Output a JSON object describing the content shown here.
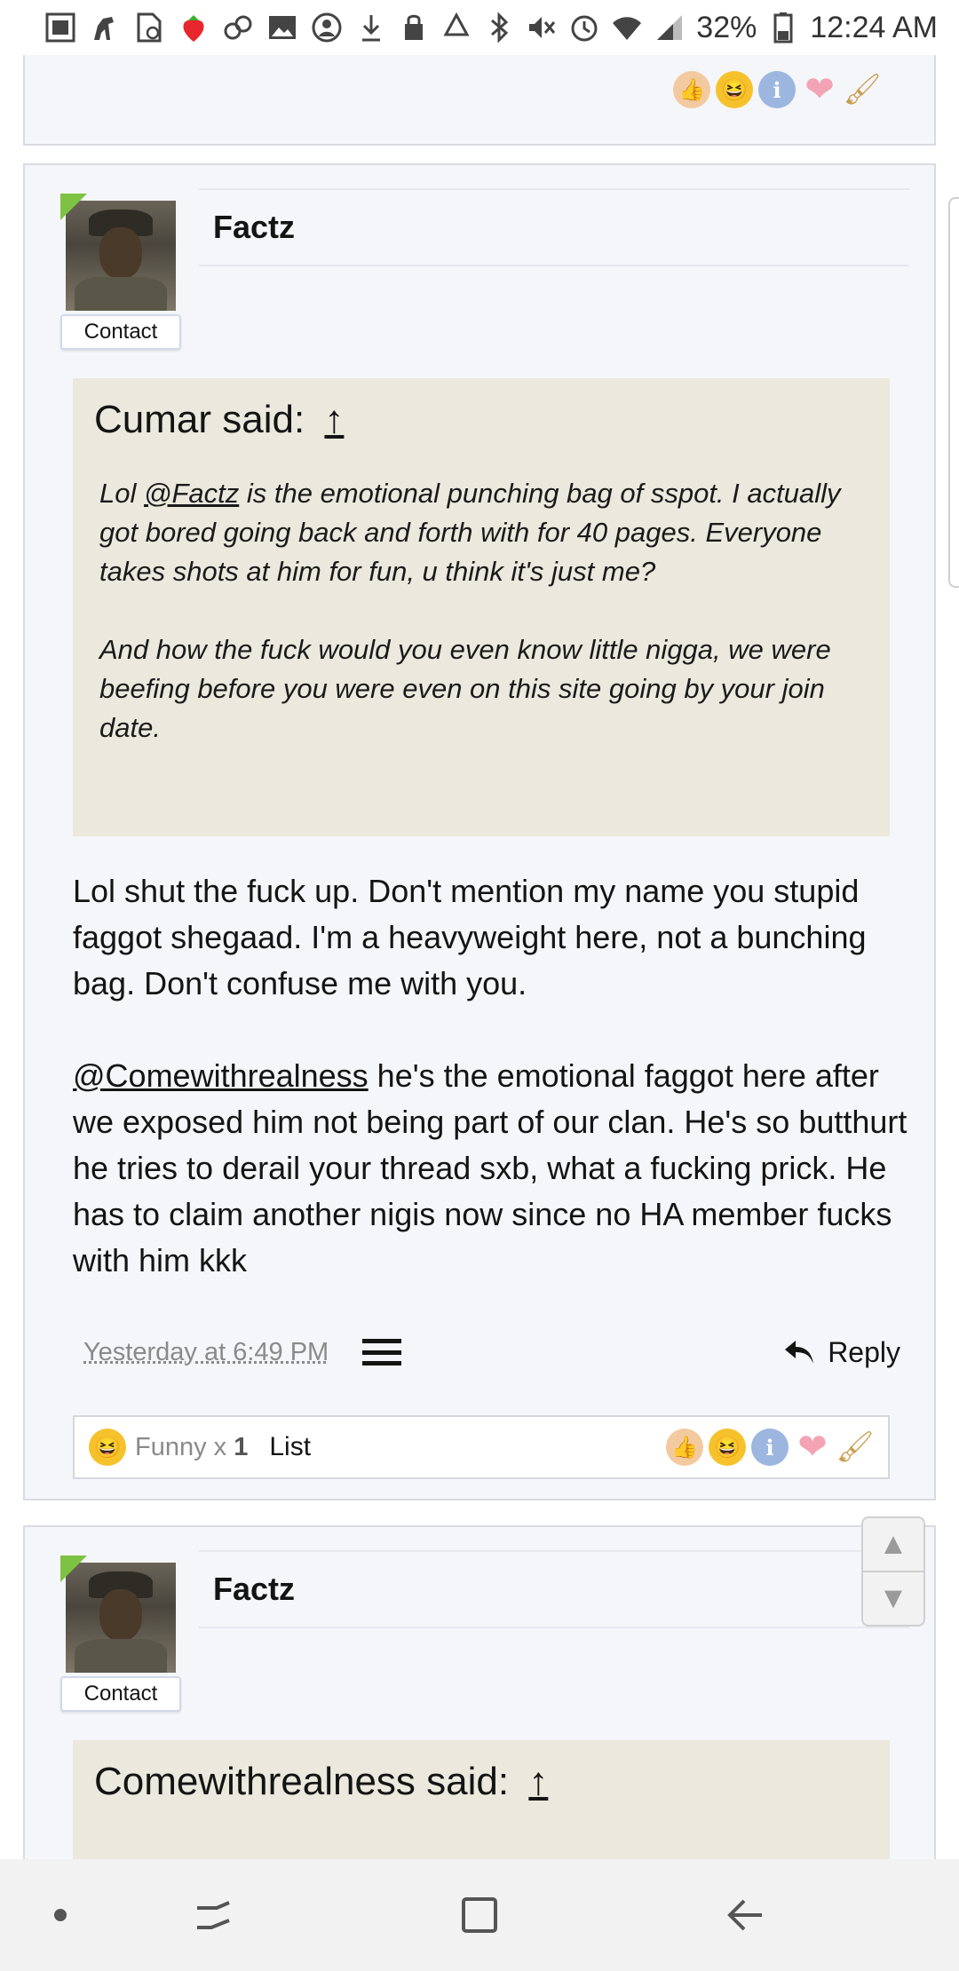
{
  "status_bar": {
    "battery": "32%",
    "time": "12:24 AM",
    "left_icons": [
      "gallery-icon",
      "horse-icon",
      "file-icon",
      "strawberry-icon",
      "link-icon",
      "image-icon",
      "account-icon",
      "download-icon"
    ],
    "right_icons": [
      "lock-icon",
      "recycle-icon",
      "bluetooth-icon",
      "mute-icon",
      "alarm-icon",
      "wifi-icon",
      "signal-icon",
      "battery-icon"
    ]
  },
  "posts": [
    {
      "username": "Factz",
      "contact_label": "Contact",
      "quote": {
        "author_said": "Cumar said:",
        "up_arrow": "↑",
        "paragraphs": [
          {
            "pre": "Lol ",
            "mention": "@Factz",
            "post": " is the emotional punching bag of sspot. I actually got bored going back and forth with for 40 pages. Everyone takes shots at him for fun, u think it's just me?"
          },
          {
            "text": "And how the fuck would you even know little nigga, we were beefing before you were even on this site going by your join date."
          }
        ]
      },
      "body": [
        {
          "text": "Lol shut the fuck up. Don't mention my name you stupid faggot shegaad. I'm a heavyweight here, not a bunching bag. Don't confuse me with you."
        },
        {
          "mention": "@Comewithrealness",
          "text": " he's the emotional faggot here after we exposed him not being part of our clan. He's so butthurt he tries to derail your thread sxb, what a fucking prick. He has to claim another nigis now since no HA member fucks with him kkk"
        }
      ],
      "date": "Yesterday at 6:49 PM",
      "reply_label": "Reply",
      "reactions": {
        "label": "Funny x ",
        "count": "1",
        "list_label": "List"
      }
    },
    {
      "username": "Factz",
      "contact_label": "Contact",
      "quote": {
        "author_said": "Comewithrealness said:",
        "up_arrow": "↑"
      }
    }
  ],
  "scroll": {
    "up": "▲",
    "down": "▼"
  },
  "nav_bar": {
    "items": [
      "dot-icon",
      "recent-apps-icon",
      "home-icon",
      "back-icon"
    ]
  }
}
